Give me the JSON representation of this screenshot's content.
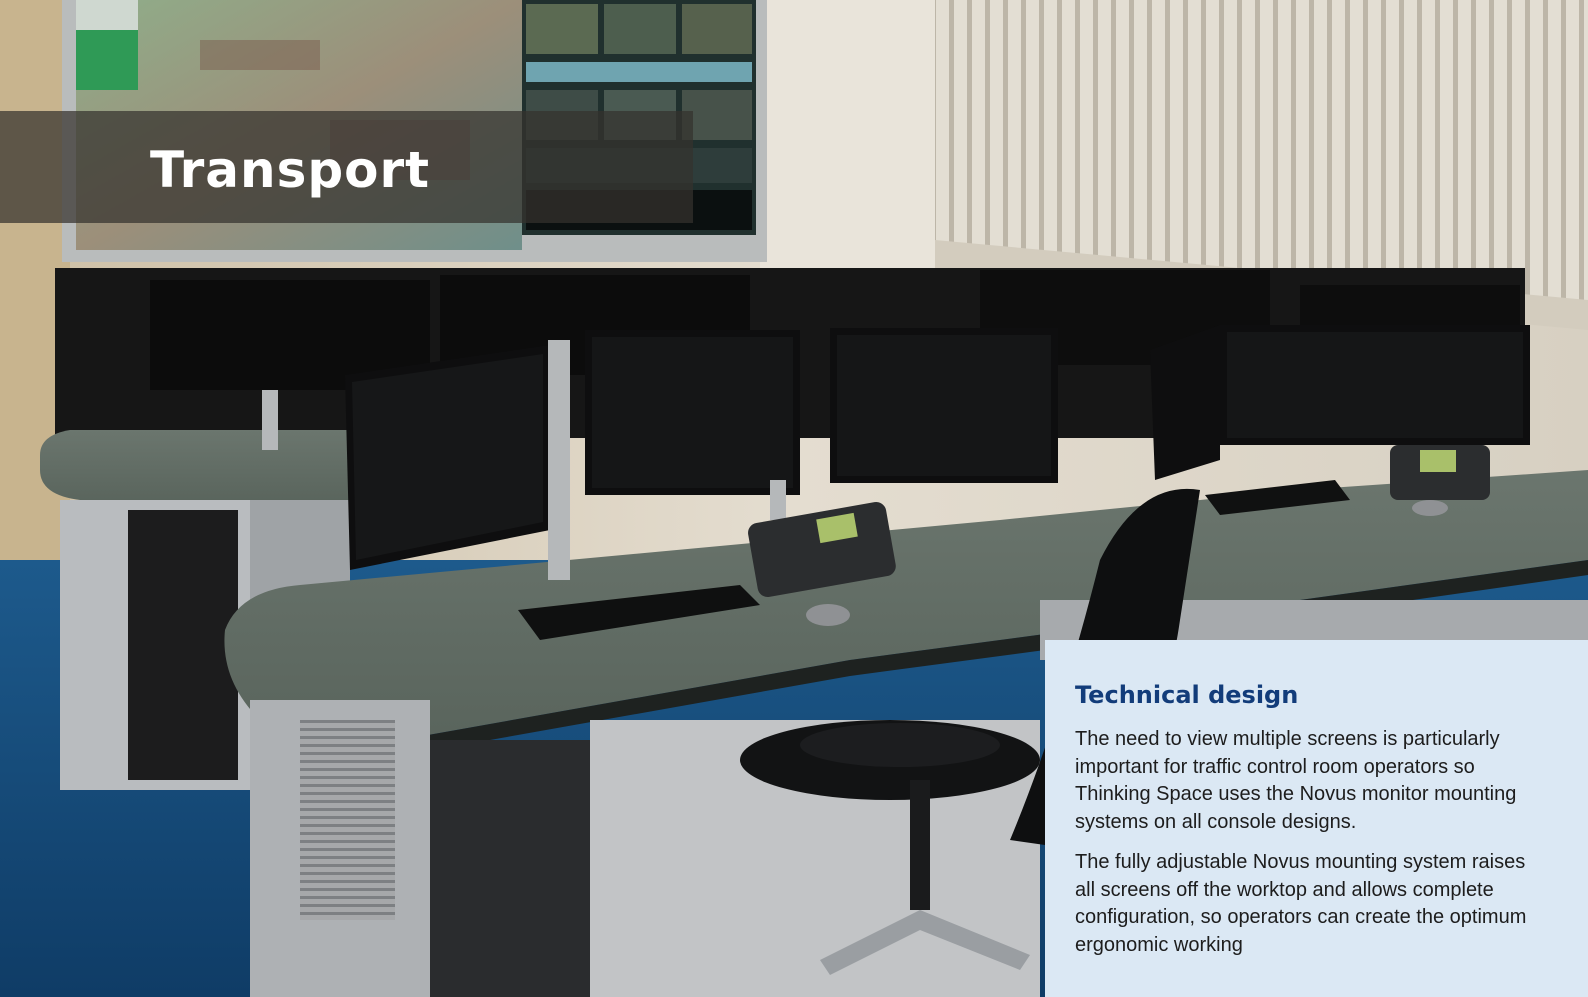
{
  "page": {
    "section_title": "Transport"
  },
  "photo": {
    "subject": "control-room-consoles",
    "colors": {
      "wall": "#d6cdbd",
      "floor": "#14497a",
      "desk_top": "#5f6b63",
      "monitor": "#0f1011",
      "blinds": "#dcd6c9"
    }
  },
  "panel": {
    "heading": "Technical design",
    "paragraphs": [
      "The need to view multiple screens is particularly important for traffic control room operators so Thinking Space uses the Novus monitor mounting systems on all console designs.",
      "The fully adjustable Novus mounting system raises all screens off the worktop and allows complete configuration, so operators can create the optimum ergonomic working"
    ],
    "colors": {
      "background": "#dbe8f4",
      "heading": "#123c7a",
      "text": "#1d1d1d"
    }
  }
}
